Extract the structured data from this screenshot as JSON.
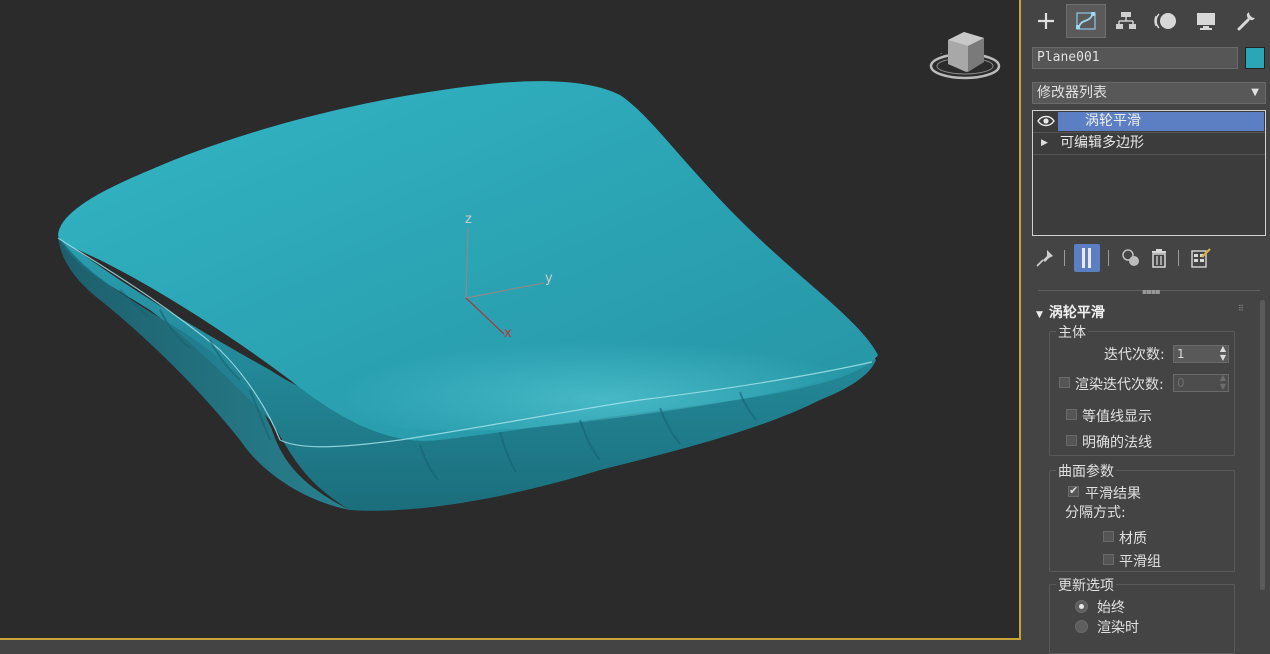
{
  "viewport": {
    "axis": {
      "x": "x",
      "y": "y",
      "z": "z"
    },
    "colors": {
      "background": "#2b2b2b",
      "object": "#2aa6b6",
      "border": "#c8a23a"
    }
  },
  "panel": {
    "tabs": [
      {
        "icon": "create-plus-icon"
      },
      {
        "icon": "modify-curve-icon"
      },
      {
        "icon": "hierarchy-icon"
      },
      {
        "icon": "motion-icon"
      },
      {
        "icon": "display-monitor-icon"
      },
      {
        "icon": "utilities-wrench-icon"
      }
    ],
    "object_name": "Plane001",
    "object_color": "#2aa6b6",
    "modifier_list": "修改器列表",
    "stack": [
      {
        "label": "涡轮平滑",
        "selected": true
      },
      {
        "label": "可编辑多边形",
        "selected": false
      }
    ],
    "rollout": {
      "title": "涡轮平滑",
      "main": {
        "title": "主体",
        "iterations_label": "迭代次数:",
        "iterations_value": "1",
        "render_iters_label": "渲染迭代次数:",
        "render_iters_value": "0",
        "isoline_label": "等值线显示",
        "explicit_normals_label": "明确的法线"
      },
      "surface": {
        "title": "曲面参数",
        "smooth_result_label": "平滑结果",
        "separate_by_label": "分隔方式:",
        "material_label": "材质",
        "smoothing_groups_label": "平滑组"
      },
      "update": {
        "title": "更新选项",
        "always_label": "始终",
        "when_rendering_label": "渲染时"
      }
    }
  }
}
